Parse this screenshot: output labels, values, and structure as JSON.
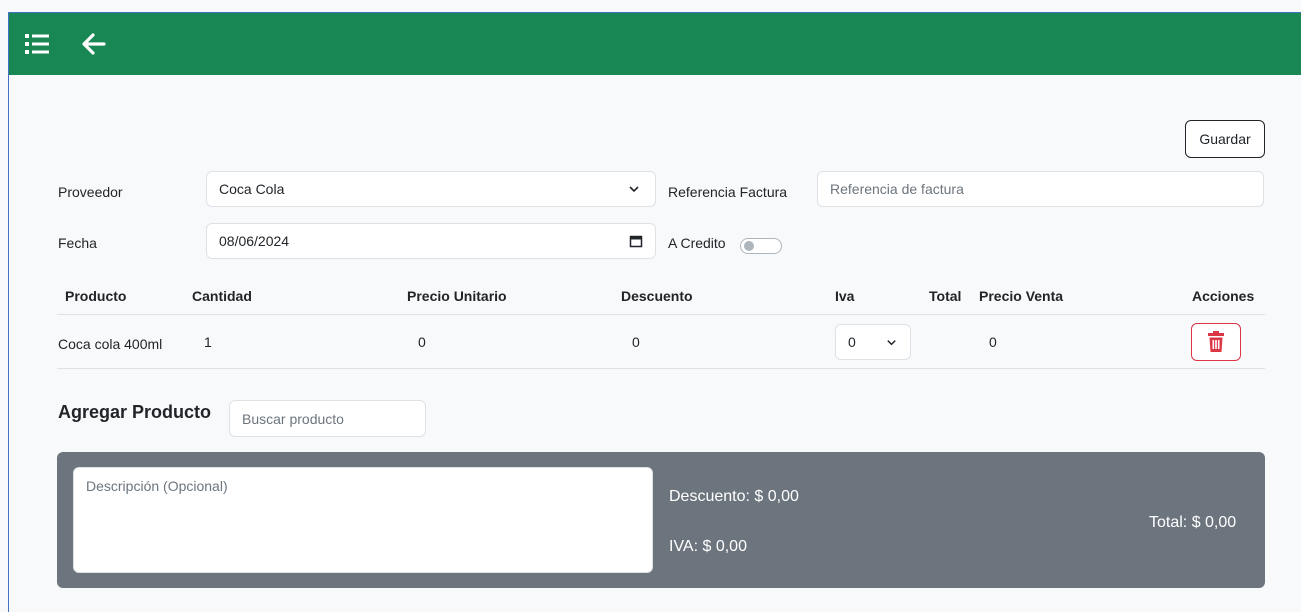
{
  "topbar": {
    "color": "#198754",
    "icons": [
      "list-icon",
      "arrow-left-icon"
    ]
  },
  "actions": {
    "save_label": "Guardar"
  },
  "form": {
    "proveedor_label": "Proveedor",
    "proveedor_value": "Coca Cola",
    "referencia_label": "Referencia Factura",
    "referencia_placeholder": "Referencia de factura",
    "fecha_label": "Fecha",
    "fecha_value": "08/06/2024",
    "credito_label": "A Credito",
    "credito_checked": false
  },
  "table": {
    "headers": [
      "Producto",
      "Cantidad",
      "Precio Unitario",
      "Descuento",
      "Iva",
      "Total",
      "Precio Venta",
      "Acciones"
    ],
    "rows": [
      {
        "producto": "Coca cola 400ml",
        "cantidad": "1",
        "precio_unitario": "0",
        "descuento": "0",
        "iva": "0",
        "total": "",
        "precio_venta": "0"
      }
    ]
  },
  "add_product": {
    "title": "Agregar Producto",
    "search_placeholder": "Buscar producto"
  },
  "summary": {
    "description_placeholder": "Descripción (Opcional)",
    "descuento": "Descuento: $ 0,00",
    "iva": "IVA: $ 0,00",
    "total": "Total: $ 0,00",
    "background": "#6c757d"
  }
}
